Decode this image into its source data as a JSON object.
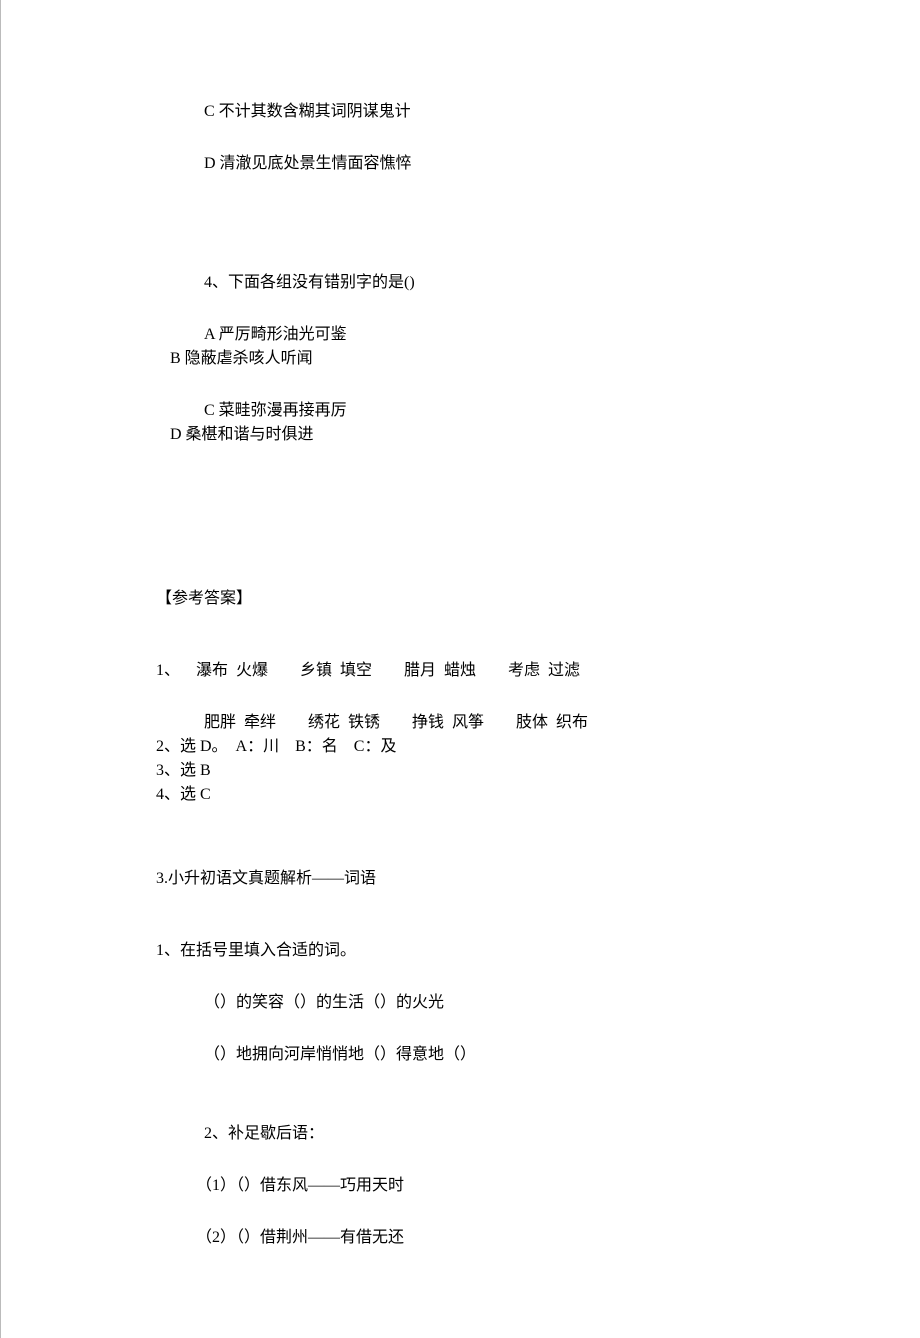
{
  "lines": {
    "optC": "C 不计其数含糊其词阴谋鬼计",
    "optD": "D 清澈见底处景生情面容憔悴",
    "q4": "4、下面各组没有错别字的是()",
    "q4a": "A 严厉畸形油光可鉴",
    "q4b": "B 隐蔽虐杀咳人听闻",
    "q4c": "C 菜畦弥漫再接再厉",
    "q4d": "D 桑椹和谐与时俱进",
    "answerHeader": "【参考答案】",
    "ans1a": "1、 瀑布 火爆  乡镇 填空  腊月 蜡烛  考虑 过滤",
    "ans1b": "肥胖 牵绊  绣花 铁锈  挣钱 风筝  肢体 织布",
    "ans2": "2、选 D。 A：川  B：名  C：及",
    "ans3": "3、选 B",
    "ans4": "4、选 C",
    "section3": "3.小升初语文真题解析——词语",
    "s3q1": "1、在括号里填入合适的词。",
    "s3q1a": "（）的笑容（）的生活（）的火光",
    "s3q1b": "（）地拥向河岸悄悄地（）得意地（）",
    "s3q2": "2、补足歇后语：",
    "s3q2a": "（1）（）借东风——巧用天时",
    "s3q2b": "（2）（）借荆州——有借无还"
  }
}
